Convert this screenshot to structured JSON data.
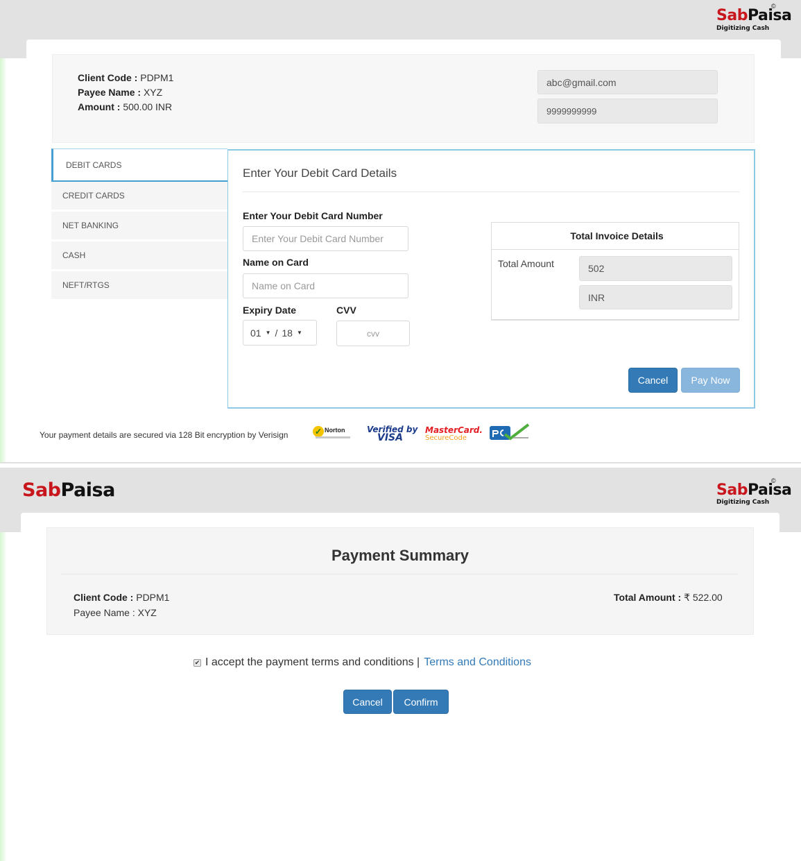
{
  "brand": {
    "sab": "Sab",
    "paisa": "Paisa",
    "tagline": "Digitizing Cash",
    "copyright": "©"
  },
  "checkout": {
    "client_code_label": "Client Code :",
    "client_code": "PDPM1",
    "payee_name_label": "Payee Name :",
    "payee_name": "XYZ",
    "amount_label": "Amount :",
    "amount": "500.00",
    "amount_currency": "INR",
    "email": "abc@gmail.com",
    "phone": "9999999999",
    "tabs": [
      "DEBIT CARDS",
      "CREDIT CARDS",
      "NET BANKING",
      "CASH",
      "NEFT/RTGS"
    ],
    "active_tab": "DEBIT CARDS",
    "form_title": "Enter Your Debit Card Details",
    "card_number_label": "Enter Your Debit Card Number",
    "card_number_placeholder": "Enter Your Debit Card Number",
    "name_label": "Name on Card",
    "name_placeholder": "Name on Card",
    "expiry_label": "Expiry Date",
    "expiry_month": "01",
    "expiry_separator": "/",
    "expiry_year": "18",
    "cvv_label": "CVV",
    "cvv_placeholder": "cvv",
    "invoice_title": "Total Invoice Details",
    "total_amount_label": "Total Amount",
    "total_amount": "502",
    "total_currency": "INR",
    "cancel_label": "Cancel",
    "pay_label": "Pay Now",
    "secure_text": "Your payment details are secured via 128 Bit encryption by Verisign",
    "badges": {
      "norton": "Norton",
      "visa_top": "Verified by",
      "visa_bottom": "VISA",
      "mc_top": "MasterCard.",
      "mc_bottom": "SecureCode"
    },
    "colors": {
      "primary": "#337ab7",
      "primary_disabled": "#89b6dc",
      "tab_accent": "#47a0d3",
      "brand_red": "#c8161d"
    }
  },
  "summary": {
    "title": "Payment Summary",
    "client_code_label": "Client Code :",
    "client_code": "PDPM1",
    "payee_name_text": "Payee Name : XYZ",
    "total_amount_label": "Total Amount :",
    "total_amount": "₹ 522.00",
    "accept_checked": true,
    "accept_text": "I accept the payment terms and conditions |",
    "terms_link": "Terms and Conditions",
    "cancel_label": "Cancel",
    "confirm_label": "Confirm"
  }
}
